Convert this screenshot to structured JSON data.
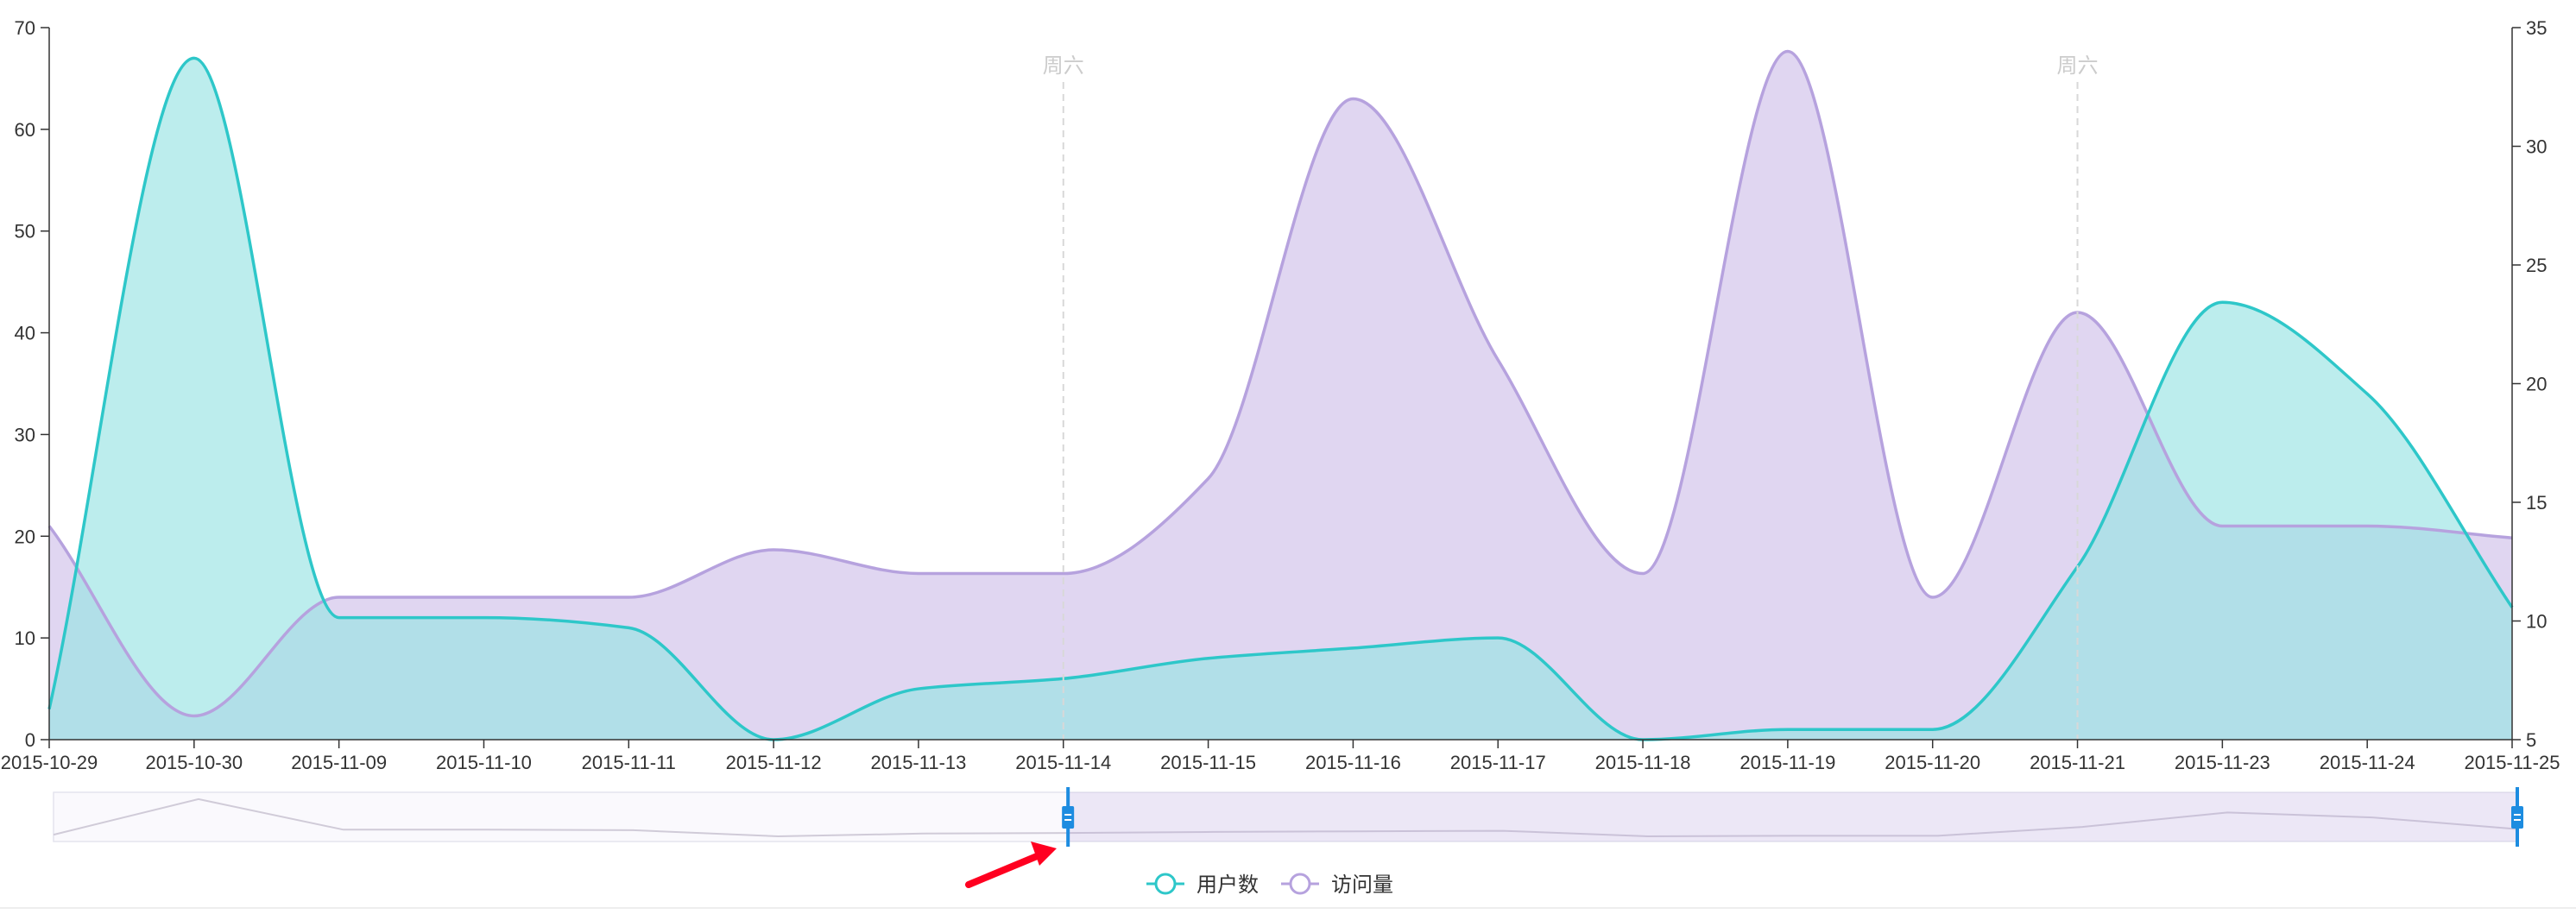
{
  "chart_data": {
    "type": "area",
    "categories": [
      "2015-10-29",
      "2015-10-30",
      "2015-11-09",
      "2015-11-10",
      "2015-11-11",
      "2015-11-12",
      "2015-11-13",
      "2015-11-14",
      "2015-11-15",
      "2015-11-16",
      "2015-11-17",
      "2015-11-18",
      "2015-11-19",
      "2015-11-20",
      "2015-11-21",
      "2015-11-23",
      "2015-11-24",
      "2015-11-25"
    ],
    "series": [
      {
        "name": "用户数",
        "axis": "left",
        "color": "#2ec7c9",
        "fill": "#98e3e4",
        "values": [
          3,
          67,
          12,
          12,
          11,
          0,
          5,
          6,
          8,
          9,
          10,
          0,
          1,
          1,
          17,
          43,
          34,
          13
        ]
      },
      {
        "name": "访问量",
        "axis": "right",
        "color": "#b6a2de",
        "fill": "#dacfee",
        "values": [
          14,
          6,
          11,
          11,
          11,
          13,
          12,
          12,
          16,
          32,
          21,
          12,
          34,
          11,
          23,
          14,
          14,
          13.5
        ]
      }
    ],
    "y_left": {
      "min": 0,
      "max": 70,
      "ticks": [
        0,
        10,
        20,
        30,
        40,
        50,
        60,
        70
      ]
    },
    "y_right": {
      "min": 5,
      "max": 35,
      "ticks": [
        5,
        10,
        15,
        20,
        25,
        30,
        35
      ]
    },
    "mark_lines": [
      {
        "category": "2015-11-14",
        "label": "周六"
      },
      {
        "category": "2015-11-21",
        "label": "周六"
      }
    ],
    "data_zoom": {
      "start_category": "2015-11-14",
      "end_category": "2015-11-25",
      "start_percent": 41,
      "end_percent": 100
    },
    "legend": {
      "position": "bottom-center",
      "items": [
        "用户数",
        "访问量"
      ]
    },
    "grid": false
  }
}
